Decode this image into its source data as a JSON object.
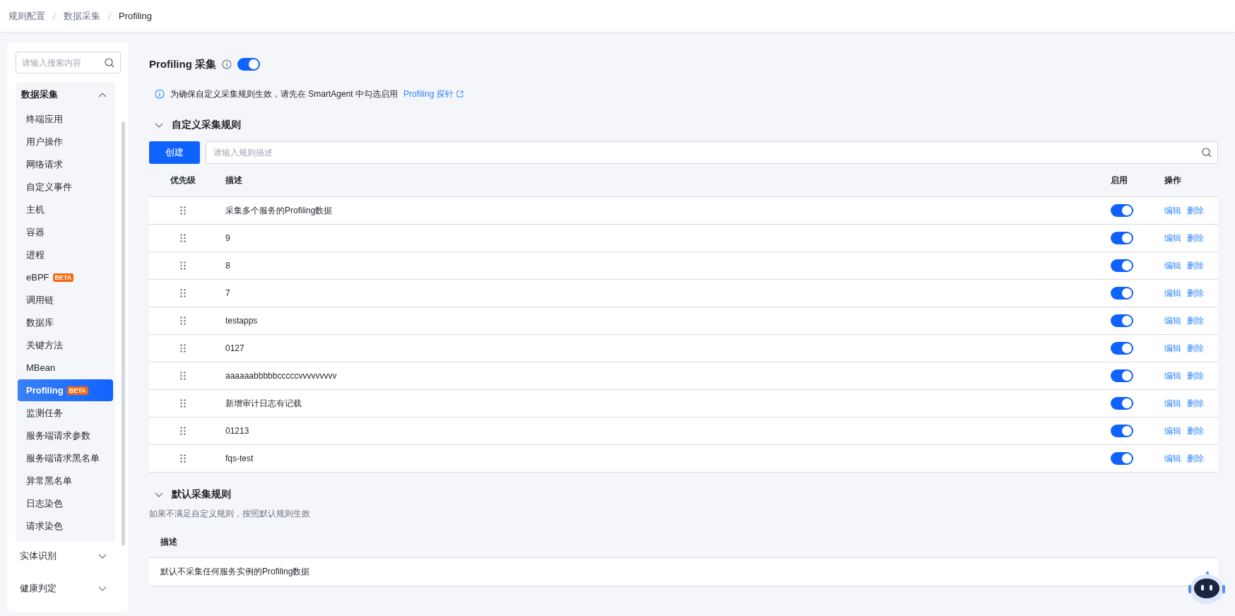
{
  "breadcrumb": [
    "规则配置",
    "数据采集",
    "Profiling"
  ],
  "sidebar": {
    "search_placeholder": "请输入搜索内容",
    "groups": [
      {
        "label": "数据采集",
        "expanded": true,
        "items": [
          {
            "label": "终端应用",
            "selected": false
          },
          {
            "label": "用户操作",
            "selected": false
          },
          {
            "label": "网络请求",
            "selected": false
          },
          {
            "label": "自定义事件",
            "selected": false
          },
          {
            "label": "主机",
            "selected": false
          },
          {
            "label": "容器",
            "selected": false
          },
          {
            "label": "进程",
            "selected": false
          },
          {
            "label": "eBPF",
            "badge": "BETA",
            "selected": false
          },
          {
            "label": "调用链",
            "selected": false
          },
          {
            "label": "数据库",
            "selected": false
          },
          {
            "label": "关键方法",
            "selected": false
          },
          {
            "label": "MBean",
            "selected": false
          },
          {
            "label": "Profiling",
            "badge": "BETA",
            "selected": true
          },
          {
            "label": "监测任务",
            "selected": false
          },
          {
            "label": "服务端请求参数",
            "selected": false
          },
          {
            "label": "服务端请求黑名单",
            "selected": false
          },
          {
            "label": "异常黑名单",
            "selected": false
          },
          {
            "label": "日志染色",
            "selected": false
          },
          {
            "label": "请求染色",
            "selected": false
          }
        ]
      },
      {
        "label": "实体识别",
        "expanded": false
      },
      {
        "label": "健康判定",
        "expanded": false
      }
    ]
  },
  "page": {
    "title": "Profiling 采集",
    "on": true
  },
  "notice": {
    "text": "为确保自定义采集规则生效，请先在 SmartAgent 中勾选启用",
    "link": "Profiling 探针"
  },
  "custom_rules": {
    "title": "自定义采集规则",
    "expanded": true,
    "create_button": "创建",
    "search_placeholder": "请输入规则描述",
    "columns": [
      "优先级",
      "描述",
      "启用",
      "操作"
    ],
    "rows": [
      {
        "description": "采集多个服务的Profiling数据",
        "on": true,
        "actions": [
          "编辑",
          "删除"
        ]
      },
      {
        "description": "9",
        "on": true,
        "actions": [
          "编辑",
          "删除"
        ]
      },
      {
        "description": "8",
        "on": true,
        "actions": [
          "编辑",
          "删除"
        ]
      },
      {
        "description": "7",
        "on": true,
        "actions": [
          "编辑",
          "删除"
        ]
      },
      {
        "description": "testapps",
        "on": true,
        "actions": [
          "编辑",
          "删除"
        ]
      },
      {
        "description": "0127",
        "on": true,
        "actions": [
          "编辑",
          "删除"
        ]
      },
      {
        "description": "aaaaaabbbbbcccccvvvvvvvvv",
        "on": true,
        "actions": [
          "编辑",
          "删除"
        ]
      },
      {
        "description": "新增审计日志有记载",
        "on": true,
        "actions": [
          "编辑",
          "删除"
        ]
      },
      {
        "description": "01213",
        "on": true,
        "actions": [
          "编辑",
          "删除"
        ]
      },
      {
        "description": "fqs-test",
        "on": true,
        "actions": [
          "编辑",
          "删除"
        ]
      }
    ]
  },
  "default_rules": {
    "title": "默认采集规则",
    "expanded": true,
    "hint": "如果不满足自定义规则，按照默认规则生效",
    "columns": [
      "描述"
    ],
    "rows": [
      "默认不采集任何服务实例的Profiling数据"
    ]
  }
}
